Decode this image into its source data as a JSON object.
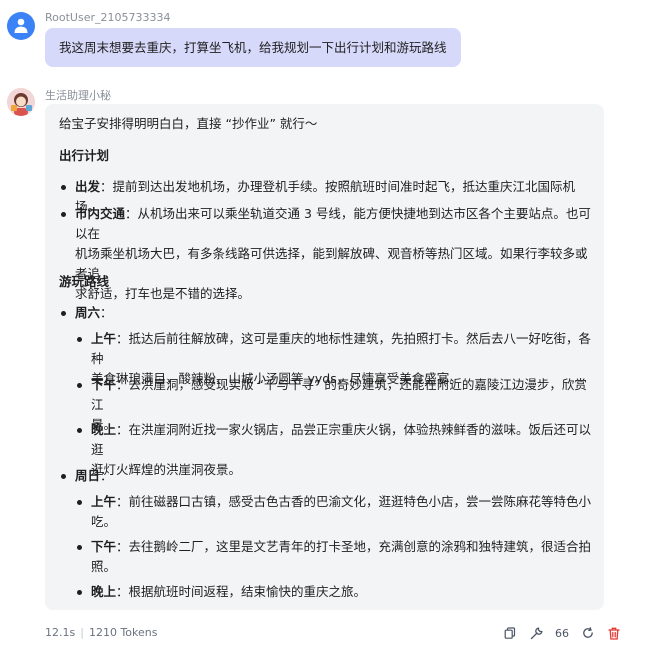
{
  "user": {
    "name": "RootUser_2105733334",
    "message": "我这周末想要去重庆，打算坐飞机，给我规划一下出行计划和游玩路线"
  },
  "bot": {
    "name": "生活助理小秘",
    "intro": "给宝子安排得明明白白，直接 “抄作业” 就行～",
    "section1": {
      "title": "出行计划",
      "items": [
        {
          "label": "出发",
          "text_lines": [
            "：提前到达出发地机场，办理登机手续。按照航班时间准时起飞，抵达重庆江北国际机场。"
          ]
        },
        {
          "label": "市内交通",
          "text_lines": [
            "：从机场出来可以乘坐轨道交通 3 号线，能方便快捷地到达市区各个主要站点。也可以在",
            "机场乘坐机场大巴，有多条线路可供选择，能到解放碑、观音桥等热门区域。如果行李较多或者追",
            "求舒适，打车也是不错的选择。"
          ]
        }
      ]
    },
    "section2": {
      "title": "游玩路线",
      "days": [
        {
          "label": "周六",
          "suffix": "：",
          "items": [
            {
              "label": "上午",
              "text_lines": [
                "：抵达后前往解放碑，这可是重庆的地标性建筑，先拍照打卡。然后去八一好吃街，各种",
                "美食琳琅满目，酸辣粉、山城小汤圆等 yyds，尽情享受美食盛宴。"
              ]
            },
            {
              "label": "下午",
              "text_lines": [
                "：去洪崖洞，感受现实版 “千与千寻” 的奇妙建筑，还能在附近的嘉陵江边漫步，欣赏江",
                "景。"
              ]
            },
            {
              "label": "晚上",
              "text_lines": [
                "：在洪崖洞附近找一家火锅店，品尝正宗重庆火锅，体验热辣鲜香的滋味。饭后还可以逛",
                "逛灯火辉煌的洪崖洞夜景。"
              ]
            }
          ]
        },
        {
          "label": "周日",
          "suffix": "：",
          "items": [
            {
              "label": "上午",
              "text_lines": [
                "：前往磁器口古镇，感受古色古香的巴渝文化，逛逛特色小店，尝一尝陈麻花等特色小",
                "吃。"
              ]
            },
            {
              "label": "下午",
              "text_lines": [
                "：去往鹅岭二厂，这里是文艺青年的打卡圣地，充满创意的涂鸦和独特建筑，很适合拍",
                "照。"
              ]
            },
            {
              "label": "晚上",
              "text_lines": [
                "：根据航班时间返程，结束愉快的重庆之旅。"
              ]
            }
          ]
        }
      ]
    }
  },
  "footer": {
    "time": "12.1s",
    "separator": "|",
    "tokens": "1210 Tokens",
    "count": "66"
  },
  "icons": [
    "user-icon",
    "assistant-avatar-icon",
    "copy-icon",
    "wrench-icon",
    "refresh-icon",
    "delete-icon"
  ],
  "colors": {
    "user_avatar": "#3b82f6",
    "user_bubble": "#d7d9fb",
    "bot_bubble": "#f3f4f6",
    "delete": "#e53935"
  }
}
